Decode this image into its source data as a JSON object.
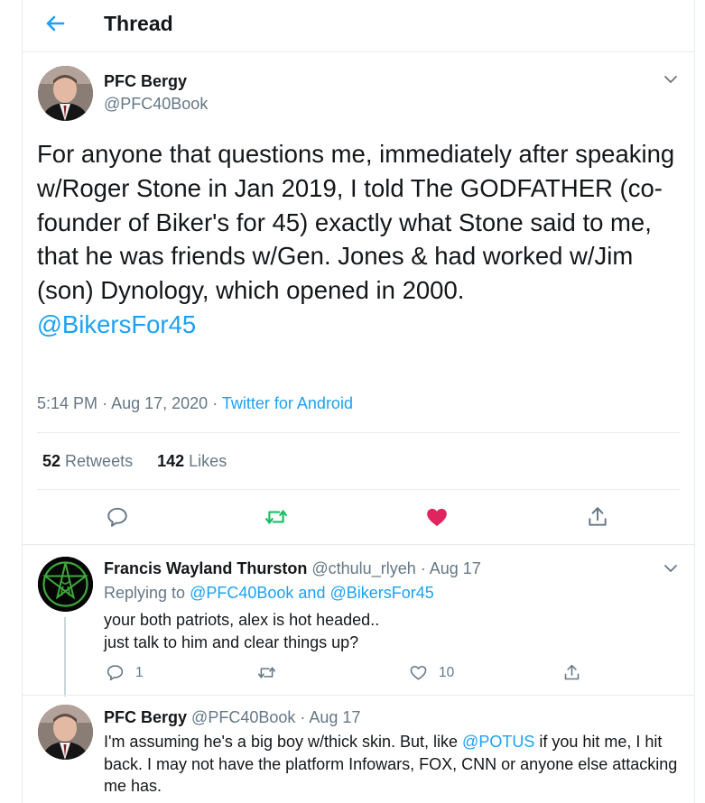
{
  "header": {
    "title": "Thread"
  },
  "tweet": {
    "author_name": "PFC Bergy",
    "author_handle": "@PFC40Book",
    "text": "For anyone that questions me, immediately after speaking w/Roger Stone in Jan 2019, I told The GODFATHER (co-founder of Biker's for 45) exactly what Stone said to me, that he was friends w/Gen. Jones & had worked w/Jim (son) Dynology, which opened in 2000.",
    "mention": "@BikersFor45",
    "time": "5:14 PM",
    "date": "Aug 17, 2020",
    "separator": "·",
    "source": "Twitter for Android",
    "retweets_count": "52",
    "retweets_label": "Retweets",
    "likes_count": "142",
    "likes_label": "Likes"
  },
  "replies": [
    {
      "name": "Francis Wayland Thurston",
      "handle": "@cthulu_rlyeh",
      "date": "Aug 17",
      "replying_prefix": "Replying to",
      "replying_user1": "@PFC40Book",
      "replying_and": "and",
      "replying_user2": "@BikersFor45",
      "line1": "your both patriots, alex is hot headed..",
      "line2": "just talk to him and clear things up?",
      "reply_count": "1",
      "like_count": "10"
    },
    {
      "name": "PFC Bergy",
      "handle": "@PFC40Book",
      "date": "Aug 17",
      "text_before": "I'm assuming he's a big boy w/thick skin. But, like ",
      "mention": "@POTUS",
      "text_after": " if you hit me, I hit back. I may not have the platform Infowars, FOX, CNN or anyone else attacking me has."
    }
  ],
  "colors": {
    "accent": "#1da1f2",
    "retweet_active": "#17bf63",
    "like_active": "#e0245e",
    "muted": "#657786"
  },
  "icons": {
    "back": "arrow-left-icon",
    "caret": "chevron-down-icon",
    "reply": "reply-icon",
    "retweet": "retweet-icon",
    "like": "heart-icon",
    "share": "share-icon"
  }
}
